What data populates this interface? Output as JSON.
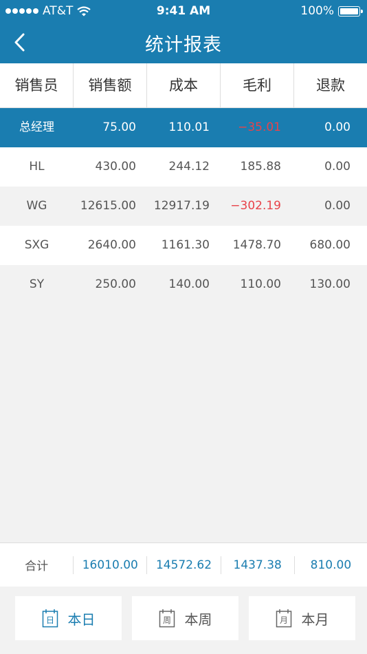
{
  "status_bar": {
    "carrier": "AT&T",
    "time": "9:41 AM",
    "battery": "100%"
  },
  "nav": {
    "title": "统计报表"
  },
  "columns": [
    "销售员",
    "销售额",
    "成本",
    "毛利",
    "退款"
  ],
  "rows": [
    {
      "name": "总经理",
      "sales": "75.00",
      "cost": "110.01",
      "profit": "−35.01",
      "refund": "0.00",
      "profit_negative": true,
      "selected": true
    },
    {
      "name": "HL",
      "sales": "430.00",
      "cost": "244.12",
      "profit": "185.88",
      "refund": "0.00",
      "profit_negative": false,
      "selected": false
    },
    {
      "name": "WG",
      "sales": "12615.00",
      "cost": "12917.19",
      "profit": "−302.19",
      "refund": "0.00",
      "profit_negative": true,
      "selected": false
    },
    {
      "name": "SXG",
      "sales": "2640.00",
      "cost": "1161.30",
      "profit": "1478.70",
      "refund": "680.00",
      "profit_negative": false,
      "selected": false
    },
    {
      "name": "SY",
      "sales": "250.00",
      "cost": "140.00",
      "profit": "110.00",
      "refund": "130.00",
      "profit_negative": false,
      "selected": false
    }
  ],
  "totals": {
    "label": "合计",
    "sales": "16010.00",
    "cost": "14572.62",
    "profit": "1437.38",
    "refund": "810.00"
  },
  "period_buttons": [
    {
      "label": "本日",
      "icon_char": "日",
      "icon": "calendar-day-icon",
      "active": true
    },
    {
      "label": "本周",
      "icon_char": "周",
      "icon": "calendar-week-icon",
      "active": false
    },
    {
      "label": "本月",
      "icon_char": "月",
      "icon": "calendar-month-icon",
      "active": false
    }
  ],
  "colors": {
    "primary": "#1a7db0",
    "negative": "#e8434a",
    "background": "#f2f2f2"
  }
}
